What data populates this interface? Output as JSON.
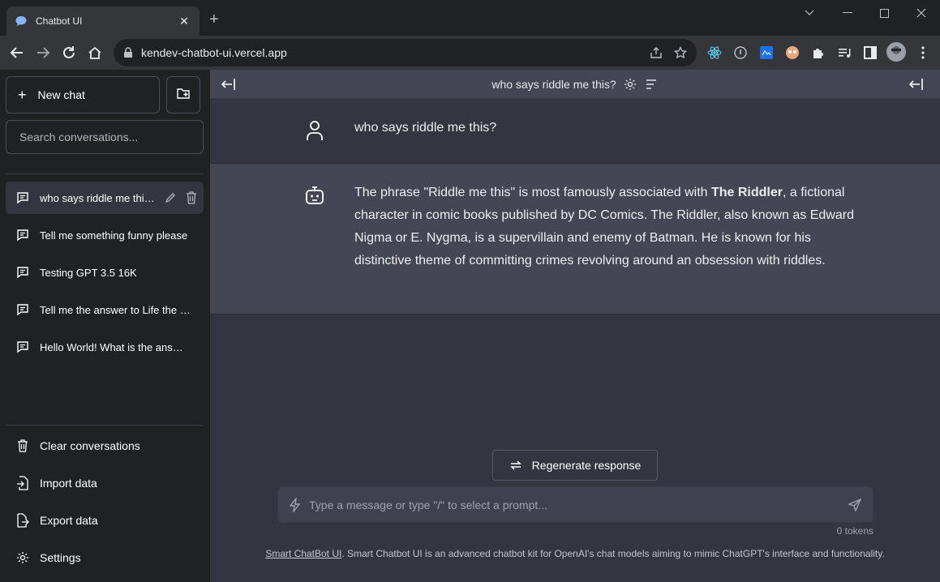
{
  "browser": {
    "tab_title": "Chatbot UI",
    "tab_close": "✕",
    "new_tab": "+",
    "url": "kendev-chatbot-ui.vercel.app"
  },
  "sidebar": {
    "new_chat_label": "New chat",
    "search_placeholder": "Search conversations...",
    "conversations": [
      {
        "label": "who says riddle me this?",
        "active": true
      },
      {
        "label": "Tell me something funny please"
      },
      {
        "label": "Testing GPT 3.5 16K"
      },
      {
        "label": "Tell me the answer to Life the Universe and Everything"
      },
      {
        "label": "Hello World! What is the answer?"
      }
    ],
    "footer": {
      "clear": "Clear conversations",
      "import": "Import data",
      "export": "Export data",
      "settings": "Settings"
    }
  },
  "main": {
    "header_title": "who says riddle me this?",
    "user_message": "who says riddle me this?",
    "bot_message": {
      "before": "The phrase \"Riddle me this\" is most famously associated with ",
      "bold": "The Riddler",
      "after": ", a fictional character in comic books published by DC Comics. The Riddler, also known as Edward Nigma or E. Nygma, is a supervillain and enemy of Batman. He is known for his distinctive theme of committing crimes revolving around an obsession with riddles."
    },
    "regenerate_label": "Regenerate response",
    "input_placeholder": "Type a message or type \"/\" to select a prompt...",
    "tokens": "0 tokens",
    "footer_link": "Smart ChatBot UI",
    "footer_text": ". Smart Chatbot UI is an advanced chatbot kit for OpenAI's chat models aiming to mimic ChatGPT's interface and functionality."
  }
}
